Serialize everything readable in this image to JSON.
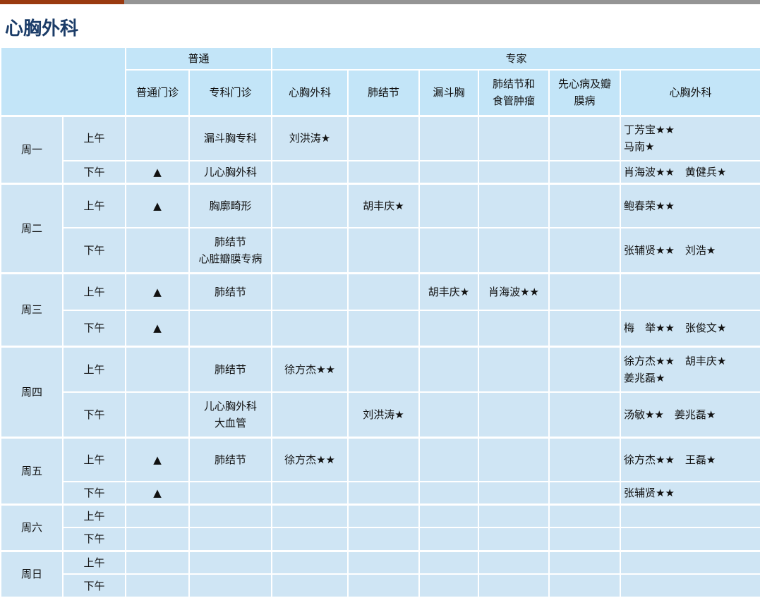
{
  "title": "心胸外科",
  "header": {
    "group_general": "普通",
    "group_expert": "专家",
    "columns": [
      "普通门诊",
      "专科门诊",
      "心胸外科",
      "肺结节",
      "漏斗胸",
      "肺结节和\n食管肿瘤",
      "先心病及瓣\n膜病",
      "心胸外科"
    ]
  },
  "schedule": [
    {
      "day": "周一",
      "slots": [
        {
          "time": "上午",
          "cells": [
            "",
            "漏斗胸专科",
            "刘洪涛★",
            "",
            "",
            "",
            "",
            "丁芳宝★★\n马南★"
          ]
        },
        {
          "time": "下午",
          "cells": [
            "▲",
            "儿心胸外科",
            "",
            "",
            "",
            "",
            "",
            "肖海波★★　黄健兵★"
          ]
        }
      ]
    },
    {
      "day": "周二",
      "slots": [
        {
          "time": "上午",
          "cells": [
            "▲",
            "胸廓畸形",
            "",
            "胡丰庆★",
            "",
            "",
            "",
            "鲍春荣★★"
          ]
        },
        {
          "time": "下午",
          "cells": [
            "",
            "肺结节\n心脏瓣膜专病",
            "",
            "",
            "",
            "",
            "",
            "张辅贤★★　刘浩★"
          ]
        }
      ]
    },
    {
      "day": "周三",
      "slots": [
        {
          "time": "上午",
          "cells": [
            "▲",
            "肺结节",
            "",
            "",
            "胡丰庆★",
            "肖海波★★",
            "",
            ""
          ]
        },
        {
          "time": "下午",
          "cells": [
            "▲",
            "",
            "",
            "",
            "",
            "",
            "",
            "梅　举★★　张俊文★"
          ]
        }
      ]
    },
    {
      "day": "周四",
      "slots": [
        {
          "time": "上午",
          "cells": [
            "",
            "肺结节",
            "徐方杰★★",
            "",
            "",
            "",
            "",
            "徐方杰★★　胡丰庆★\n姜兆磊★"
          ]
        },
        {
          "time": "下午",
          "cells": [
            "",
            "儿心胸外科\n大血管",
            "",
            "刘洪涛★",
            "",
            "",
            "",
            "汤敏★★　姜兆磊★"
          ]
        }
      ]
    },
    {
      "day": "周五",
      "slots": [
        {
          "time": "上午",
          "cells": [
            "▲",
            "肺结节",
            "徐方杰★★",
            "",
            "",
            "",
            "",
            "徐方杰★★　王磊★"
          ]
        },
        {
          "time": "下午",
          "cells": [
            "▲",
            "",
            "",
            "",
            "",
            "",
            "",
            "张辅贤★★"
          ]
        }
      ]
    },
    {
      "day": "周六",
      "slots": [
        {
          "time": "上午",
          "cells": [
            "",
            "",
            "",
            "",
            "",
            "",
            "",
            ""
          ]
        },
        {
          "time": "下午",
          "cells": [
            "",
            "",
            "",
            "",
            "",
            "",
            "",
            ""
          ]
        }
      ]
    },
    {
      "day": "周日",
      "slots": [
        {
          "time": "上午",
          "cells": [
            "",
            "",
            "",
            "",
            "",
            "",
            "",
            ""
          ]
        },
        {
          "time": "下午",
          "cells": [
            "",
            "",
            "",
            "",
            "",
            "",
            "",
            ""
          ]
        }
      ]
    }
  ]
}
